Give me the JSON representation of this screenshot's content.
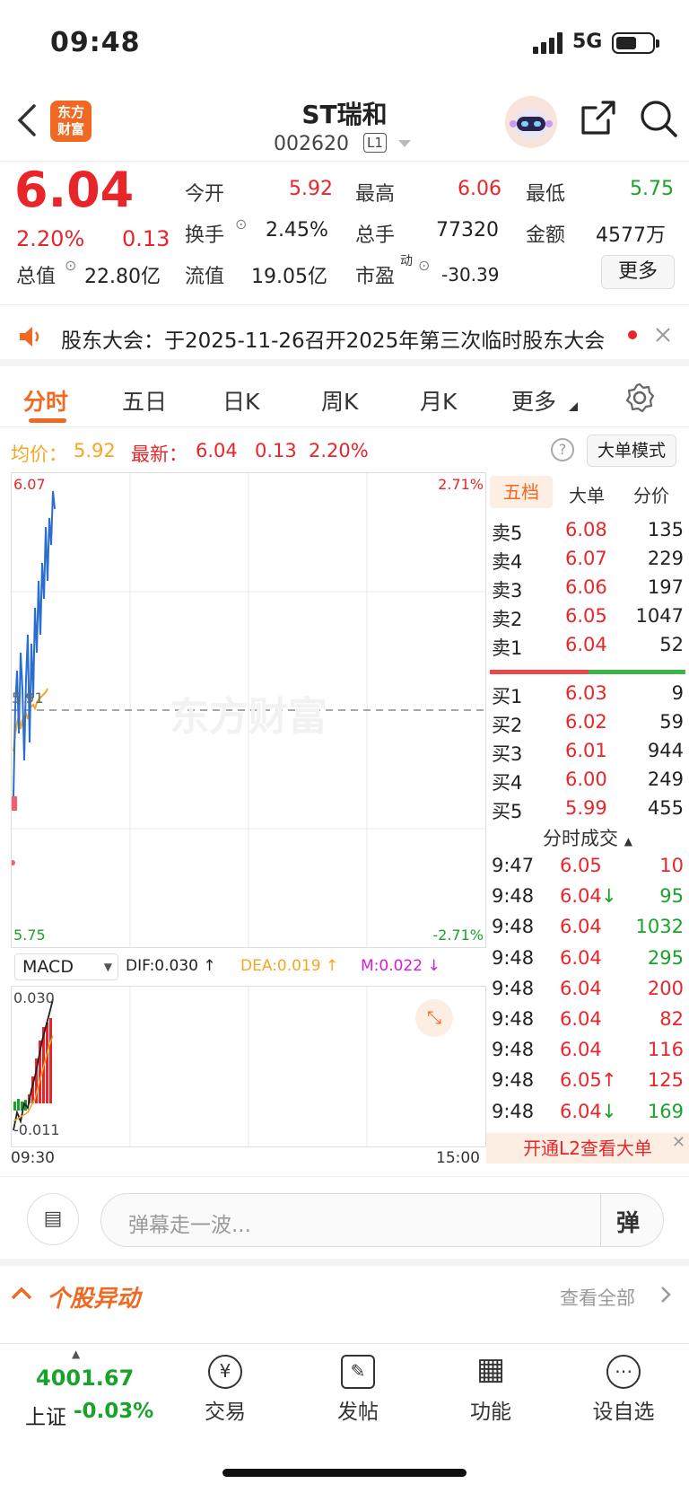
{
  "status": {
    "time": "09:48",
    "network": "5G"
  },
  "header": {
    "logo_line1": "东方",
    "logo_line2": "财富",
    "name": "ST瑞和",
    "code": "002620",
    "level": "L1"
  },
  "quote": {
    "price": "6.04",
    "pct": "2.20%",
    "change": "0.13",
    "open_label": "今开",
    "open": "5.92",
    "high_label": "最高",
    "high": "6.06",
    "low_label": "最低",
    "low": "5.75",
    "turnover_label": "换手",
    "turnover": "2.45%",
    "volume_label": "总手",
    "volume": "77320",
    "amount_label": "金额",
    "amount": "4577万",
    "mcap_label": "总值",
    "mcap": "22.80亿",
    "float_label": "流值",
    "float": "19.05亿",
    "pe_label": "市盈",
    "pe_sup": "动",
    "pe": "-30.39",
    "more": "更多"
  },
  "notice": {
    "text": "股东大会：于2025-11-26召开2025年第三次临时股东大会"
  },
  "tabs": [
    "分时",
    "五日",
    "日K",
    "周K",
    "月K",
    "更多"
  ],
  "pricebar": {
    "avg_label": "均价：",
    "avg": "5.92",
    "latest_label": "最新：",
    "latest": "6.04",
    "change": "0.13",
    "pct": "2.20%",
    "mode_button": "大单模式"
  },
  "chart": {
    "top_price": "6.07",
    "top_pct": "2.71%",
    "mid_price": "5.91",
    "bottom_price": "5.75",
    "bottom_pct": "-2.71%",
    "watermark": "东方财富",
    "start_time": "09:30",
    "end_time": "15:00"
  },
  "macd": {
    "selector": "MACD",
    "dif": "DIF:0.030",
    "dea": "DEA:0.019",
    "m": "M:0.022",
    "top": "0.030",
    "bottom": "-0.011"
  },
  "orderbook": {
    "tabs": [
      "五档",
      "大单",
      "分价"
    ],
    "asks": [
      {
        "label": "卖5",
        "price": "6.08",
        "vol": "135"
      },
      {
        "label": "卖4",
        "price": "6.07",
        "vol": "229"
      },
      {
        "label": "卖3",
        "price": "6.06",
        "vol": "197"
      },
      {
        "label": "卖2",
        "price": "6.05",
        "vol": "1047"
      },
      {
        "label": "卖1",
        "price": "6.04",
        "vol": "52"
      }
    ],
    "bids": [
      {
        "label": "买1",
        "price": "6.03",
        "vol": "9"
      },
      {
        "label": "买2",
        "price": "6.02",
        "vol": "59"
      },
      {
        "label": "买3",
        "price": "6.01",
        "vol": "944"
      },
      {
        "label": "买4",
        "price": "6.00",
        "vol": "249"
      },
      {
        "label": "买5",
        "price": "5.99",
        "vol": "455"
      }
    ]
  },
  "ticks": {
    "title": "分时成交",
    "rows": [
      {
        "time": "9:47",
        "price": "6.05",
        "arrow": "",
        "vol": "10",
        "side": "buy"
      },
      {
        "time": "9:48",
        "price": "6.04",
        "arrow": "↓",
        "vol": "95",
        "side": "sell"
      },
      {
        "time": "9:48",
        "price": "6.04",
        "arrow": "",
        "vol": "1032",
        "side": "sell"
      },
      {
        "time": "9:48",
        "price": "6.04",
        "arrow": "",
        "vol": "295",
        "side": "sell"
      },
      {
        "time": "9:48",
        "price": "6.04",
        "arrow": "",
        "vol": "200",
        "side": "buy"
      },
      {
        "time": "9:48",
        "price": "6.04",
        "arrow": "",
        "vol": "82",
        "side": "buy"
      },
      {
        "time": "9:48",
        "price": "6.04",
        "arrow": "",
        "vol": "116",
        "side": "buy"
      },
      {
        "time": "9:48",
        "price": "6.05",
        "arrow": "↑",
        "vol": "125",
        "side": "buy"
      },
      {
        "time": "9:48",
        "price": "6.04",
        "arrow": "↓",
        "vol": "169",
        "side": "sell"
      }
    ]
  },
  "promo": "开通L2查看大单",
  "comment": {
    "placeholder": "弹幕走一波...",
    "danmu": "弹"
  },
  "abnormal": {
    "title": "个股异动",
    "view_all": "查看全部"
  },
  "bottom_nav": {
    "index_value": "4001.67",
    "index_name": "上证",
    "index_change": "-0.03%",
    "items": [
      {
        "label": "交易",
        "icon": "¥"
      },
      {
        "label": "发帖",
        "icon": "✎"
      },
      {
        "label": "功能",
        "icon": "▦"
      },
      {
        "label": "设自选",
        "icon": "⋯"
      }
    ]
  },
  "colors": {
    "accent": "#f16822",
    "up": "#e8262a",
    "down": "#1aa32a",
    "avg": "#f5a623",
    "price_line": "#2a6fd0"
  }
}
